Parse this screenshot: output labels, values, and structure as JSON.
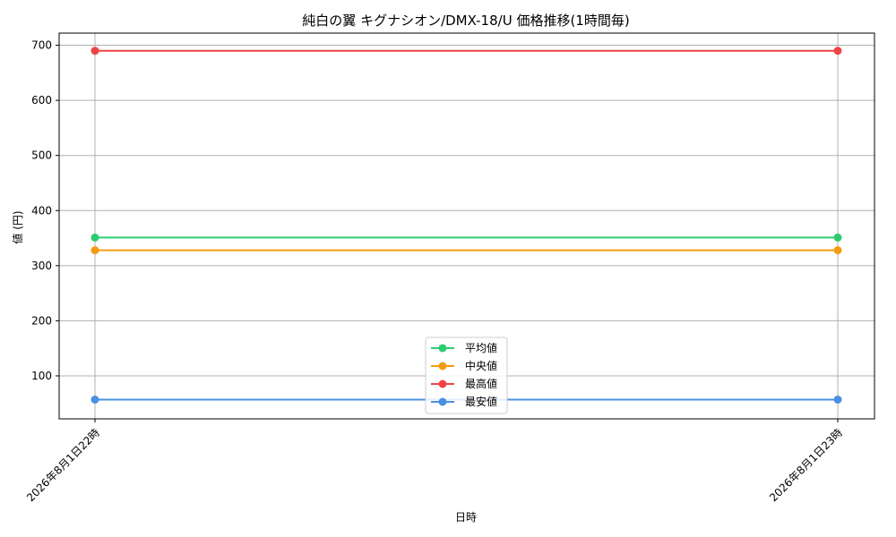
{
  "chart_data": {
    "type": "line",
    "title": "純白の翼 キグナシオン/DMX-18/U 価格推移(1時間毎)",
    "xlabel": "日時",
    "ylabel": "値 (円)",
    "categories": [
      "2026年8月1日22時",
      "2026年8月1日23時"
    ],
    "ylim": [
      22,
      722
    ],
    "yticks": [
      100,
      200,
      300,
      400,
      500,
      600,
      700
    ],
    "grid": true,
    "legend_position": "bottom-center",
    "series": [
      {
        "name": "平均値",
        "values": [
          351,
          351
        ],
        "color": "#2ecc71"
      },
      {
        "name": "中央値",
        "values": [
          328,
          328
        ],
        "color": "#f39c12"
      },
      {
        "name": "最高値",
        "values": [
          690,
          690
        ],
        "color": "#ef4444"
      },
      {
        "name": "最安値",
        "values": [
          57,
          57
        ],
        "color": "#4a90e2"
      }
    ]
  }
}
